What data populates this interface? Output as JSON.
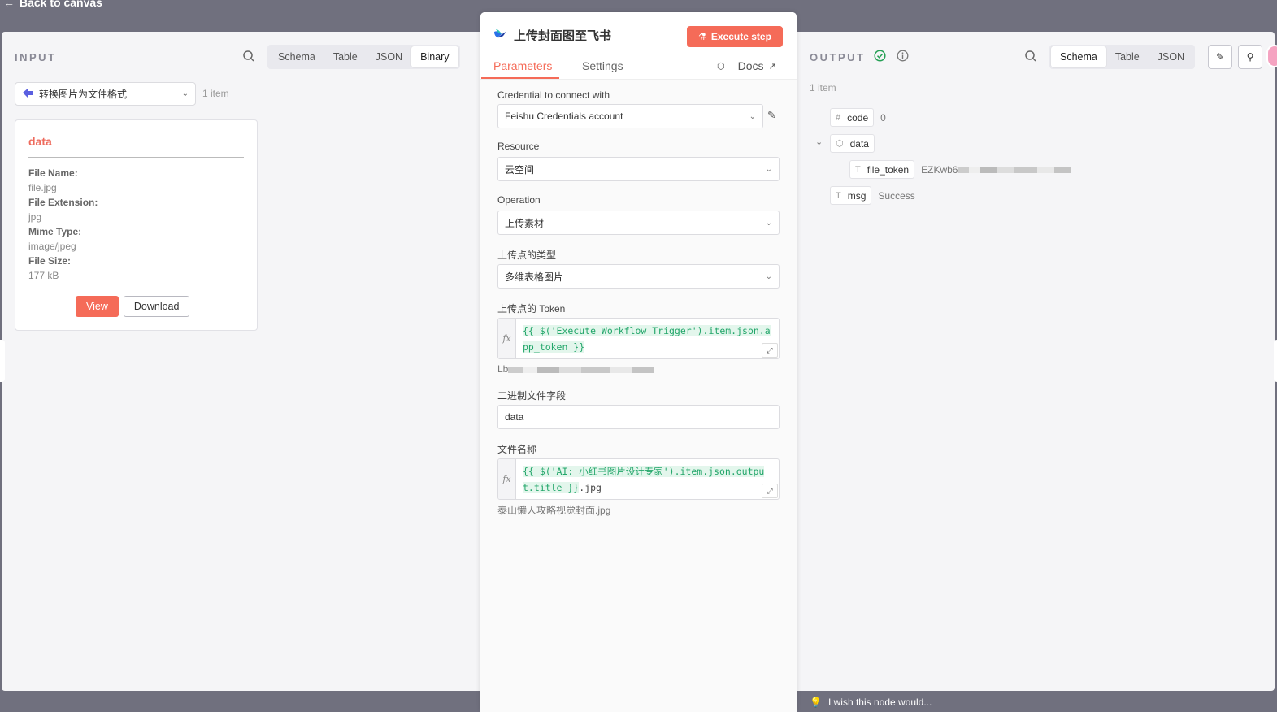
{
  "back": {
    "label": "Back to canvas"
  },
  "input": {
    "title": "INPUT",
    "views": [
      "Schema",
      "Table",
      "JSON",
      "Binary"
    ],
    "active_view": "Binary",
    "node_select": "转换图片为文件格式",
    "items": "1 item",
    "binary": {
      "title": "data",
      "fields": [
        {
          "k": "File Name:",
          "v": "file.jpg"
        },
        {
          "k": "File Extension:",
          "v": "jpg"
        },
        {
          "k": "Mime Type:",
          "v": "image/jpeg"
        },
        {
          "k": "File Size:",
          "v": "177 kB"
        }
      ],
      "view_label": "View",
      "download_label": "Download"
    }
  },
  "node": {
    "title": "上传封面图至飞书",
    "execute_label": "Execute step",
    "tabs": [
      "Parameters",
      "Settings"
    ],
    "docs_label": "Docs",
    "credential_label": "Credential to connect with",
    "credential_value": "Feishu Credentials account",
    "resource_label": "Resource",
    "resource_value": "云空间",
    "operation_label": "Operation",
    "operation_value": "上传素材",
    "upload_type_label": "上传点的类型",
    "upload_type_value": "多维表格图片",
    "token_label": "上传点的 Token",
    "token_expr": "{{ $('Execute Workflow Trigger').item.json.app_token }}",
    "token_hint_prefix": "Lb",
    "binary_field_label": "二进制文件字段",
    "binary_field_value": "data",
    "filename_label": "文件名称",
    "filename_expr": "{{ $('AI: 小红书图片设计专家').item.json.output.title }}",
    "filename_suffix": ".jpg",
    "filename_hint": "泰山懒人攻略视觉封面.jpg"
  },
  "output": {
    "title": "OUTPUT",
    "views": [
      "Schema",
      "Table",
      "JSON"
    ],
    "active_view": "Schema",
    "items": "1 item",
    "rows": [
      {
        "key": "code",
        "type_icon": "#",
        "value": "0"
      },
      {
        "key": "data",
        "type_icon": "⬡",
        "value": ""
      },
      {
        "key": "file_token",
        "type_icon": "T",
        "value": "EZKwb6"
      },
      {
        "key": "msg",
        "type_icon": "T",
        "value": "Success"
      }
    ]
  },
  "feedback": {
    "label": "I wish this node would..."
  },
  "colors": {
    "accent": "#f56b58",
    "success": "#25a055",
    "expr_green": "#23a66a"
  }
}
